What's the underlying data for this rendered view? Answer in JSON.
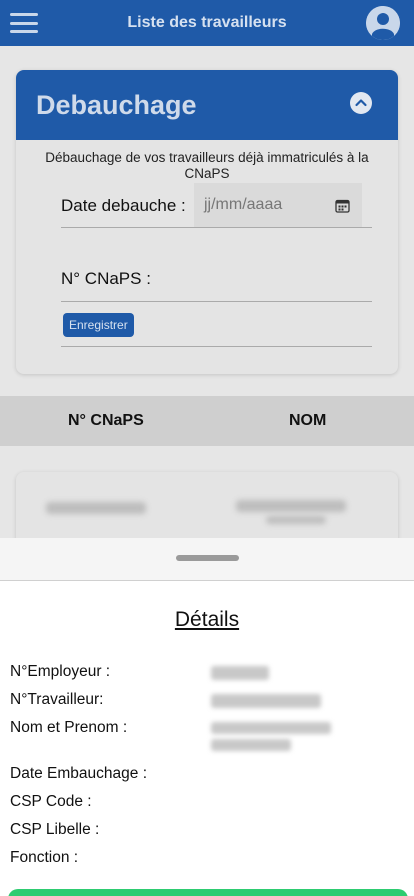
{
  "topbar": {
    "title": "Liste des travailleurs"
  },
  "card": {
    "header": "Debauchage",
    "description": "Débauchage de vos travailleurs déjà immatriculés à la CNaPS",
    "date_label": "Date debauche :",
    "date_placeholder": "jj/mm/aaaa",
    "cnaps_label": "N° CNaPS :",
    "submit_label": "Enregistrer"
  },
  "table": {
    "columns": [
      "N° CNaPS",
      "NOM"
    ]
  },
  "sheet": {
    "title": "Détails",
    "fields": [
      {
        "label": "N°Employeur :"
      },
      {
        "label": "N°Travailleur:"
      },
      {
        "label": "Nom et Prenom :"
      },
      {
        "label": "Date Embauchage :"
      },
      {
        "label": "CSP Code :"
      },
      {
        "label": "CSP Libelle :"
      },
      {
        "label": "Fonction :"
      }
    ]
  },
  "colors": {
    "primary": "#1f5aa8",
    "accent": "#2ecc71"
  }
}
